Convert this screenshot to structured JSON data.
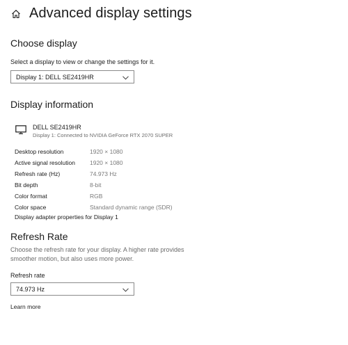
{
  "header": {
    "title": "Advanced display settings",
    "home_icon": "home-icon"
  },
  "choose_display": {
    "title": "Choose display",
    "description": "Select a display to view or change the settings for it.",
    "selected": "Display 1: DELL SE2419HR"
  },
  "display_info": {
    "title": "Display information",
    "monitor_icon": "monitor-icon",
    "monitor_name": "DELL SE2419HR",
    "monitor_sub": "Display 1: Connected to NVIDIA GeForce RTX 2070 SUPER",
    "rows": [
      {
        "label": "Desktop resolution",
        "value": "1920 × 1080"
      },
      {
        "label": "Active signal resolution",
        "value": "1920 × 1080"
      },
      {
        "label": "Refresh rate (Hz)",
        "value": "74.973 Hz"
      },
      {
        "label": "Bit depth",
        "value": "8-bit"
      },
      {
        "label": "Color format",
        "value": "RGB"
      },
      {
        "label": "Color space",
        "value": "Standard dynamic range (SDR)"
      }
    ],
    "adapter_link": "Display adapter properties for Display 1"
  },
  "refresh_rate": {
    "title": "Refresh Rate",
    "description": "Choose the refresh rate for your display. A higher rate provides smoother motion, but also uses more power.",
    "field_label": "Refresh rate",
    "selected": "74.973 Hz",
    "learn_more": "Learn more"
  },
  "colors": {
    "text": "#1a1a1a",
    "muted": "#6b6b6b",
    "border": "#8a8a8a",
    "background": "#ffffff"
  }
}
